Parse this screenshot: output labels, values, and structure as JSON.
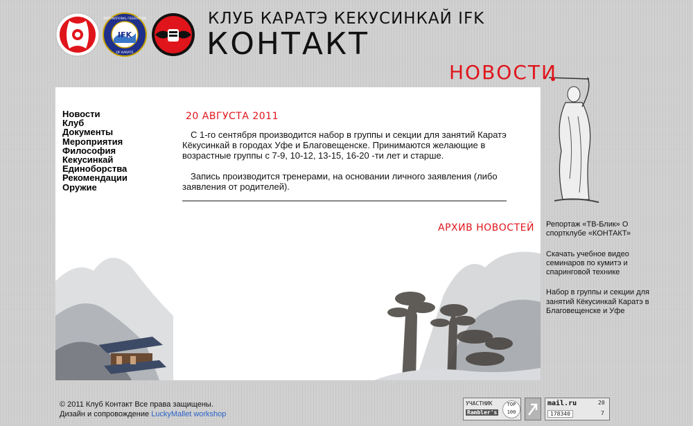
{
  "header": {
    "title_line1": "КЛУБ КАРАТЭ КЕКУСИНКАЙ IFK",
    "title_line2": "КОНТАКТ",
    "section_title": "НОВОСТИ",
    "ifk_logo_text": "IFK",
    "ifk_logo_ring_top": "INTERNATIONAL FEDERATION",
    "ifk_logo_ring_bottom": "OF KARATE"
  },
  "nav": {
    "items": [
      "Новости",
      "Клуб",
      "Документы",
      "Мероприятия",
      "Философия",
      "Кекусинкай",
      "Единоборства",
      "Рекомендации",
      "Оружие"
    ]
  },
  "news": {
    "date": "20 АВГУСТА 2011",
    "paragraph1": "С 1-го сентября производится набор в группы и секции для занятий Каратэ Кёкусинкай в городах Уфе и Благовещенске. Принимаются желающие в возрастные группы с 7-9, 10-12, 13-15, 16-20 -ти лет и старше.",
    "paragraph2": "Запись производится тренерами, на основании личного заявления (либо заявления от родителей).",
    "archive_label": "АРХИВ НОВОСТЕЙ"
  },
  "sidebar": {
    "links": [
      "Репортаж «ТВ-Блик» О спортклубе «КОНТАКТ»",
      "Скачать учебное видео семинаров по кумитэ и спаринговой технике",
      "Набор в группы и секции для занятий Кёкусинкай Каратэ в Благовещенске и Уфе"
    ]
  },
  "footer": {
    "copyright": "© 2011 Клуб Контакт Все права защищены.",
    "design_prefix": "Дизайн и сопровождение",
    "design_link": "LuckyMallet workshop"
  },
  "counters": {
    "rambler_top": "УЧАСТНИК",
    "rambler_name": "Rambler's",
    "rambler_badge": "TOP 100",
    "mail_logo": "mail.ru",
    "mail_value": "178340",
    "mail_small1": "20",
    "mail_small2": "7"
  },
  "colors": {
    "accent_red": "#e0141b",
    "link_blue": "#2a62c8",
    "page_bg": "#cfcfcf"
  }
}
